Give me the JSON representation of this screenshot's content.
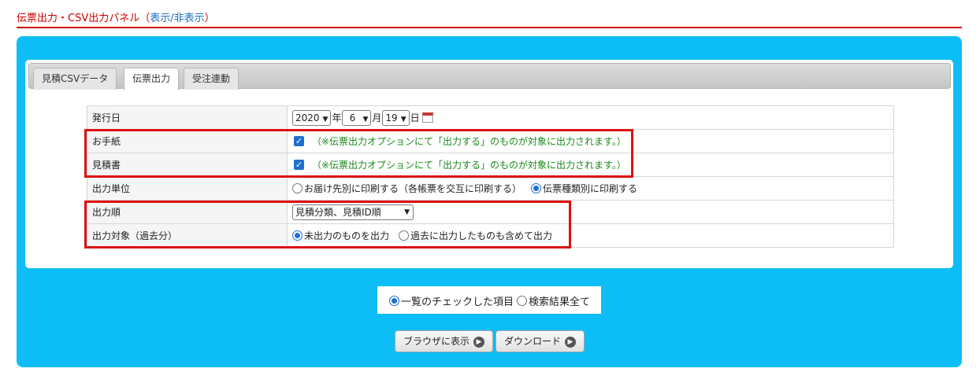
{
  "panel": {
    "title": "伝票出力・CSV出力パネル（",
    "toggle_link": "表示/非表示",
    "title_close": "）"
  },
  "tabs": [
    {
      "label": "見積CSVデータ"
    },
    {
      "label": "伝票出力"
    },
    {
      "label": "受注連動"
    }
  ],
  "form": {
    "issue_date": {
      "label": "発行日",
      "year": "2020",
      "year_unit": "年",
      "month": "6",
      "month_unit": "月",
      "day": "19",
      "day_unit": "日"
    },
    "letter": {
      "label": "お手紙",
      "checked": true,
      "note": "（※伝票出力オプションにて「出力する」のものが対象に出力されます。）"
    },
    "estimate": {
      "label": "見積書",
      "checked": true,
      "note": "（※伝票出力オプションにて「出力する」のものが対象に出力されます。）"
    },
    "output_unit": {
      "label": "出力単位",
      "option1": "お届け先別に印刷する（各帳票を交互に印刷する）",
      "option2": "伝票種類別に印刷する",
      "selected": "option2"
    },
    "output_order": {
      "label": "出力順",
      "value": "見積分類、見積ID順"
    },
    "output_target": {
      "label": "出力対象（過去分）",
      "option1": "未出力のものを出力",
      "option2": "過去に出力したものも含めて出力",
      "selected": "option1"
    }
  },
  "scope": {
    "option1": "一覧のチェックした項目",
    "option2": "検索結果全て",
    "selected": "option1"
  },
  "buttons": {
    "browser_label": "ブラウザに表示",
    "download_label": "ダウンロード"
  },
  "colors": {
    "accent_red": "#cc0000",
    "link_blue": "#1a6fc4",
    "panel_blue": "#0dbdf5",
    "note_green": "#1a8a1a",
    "highlight_red": "#dd1111"
  }
}
